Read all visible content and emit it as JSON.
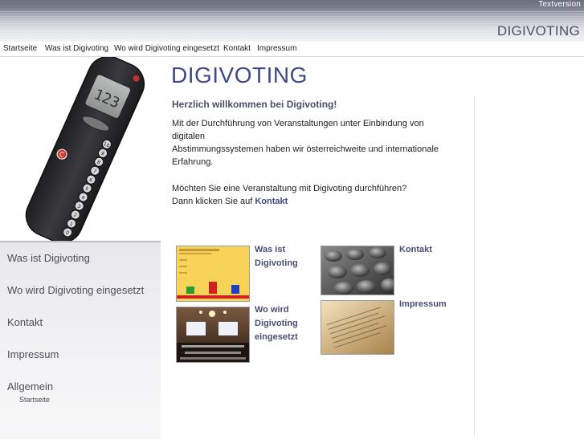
{
  "header": {
    "textversion_label": "Textversion",
    "brand": "DIGIVOTING"
  },
  "topnav": {
    "items": [
      "Startseite",
      "Was ist Digivoting",
      "Wo wird Digivoting eingesetzt",
      "Kontakt",
      "Impressum"
    ]
  },
  "device": {
    "display_value": "123",
    "keys": [
      "10",
      "9",
      "8",
      "7",
      "6",
      "5",
      "4",
      "3",
      "2",
      "1",
      "0"
    ],
    "clear_key": "C"
  },
  "sidebar": {
    "items": [
      "Was ist Digivoting",
      "Wo wird Digivoting eingesetzt",
      "Kontakt",
      "Impressum",
      "Allgemein"
    ],
    "sub_items": [
      "Startseite"
    ]
  },
  "main": {
    "title": "DIGIVOTING",
    "welcome": "Herzlich willkommen bei Digivoting!",
    "intro_lines": [
      "Mit der Durchführung von Veranstaltungen unter Einbindung von",
      "digitalen",
      "Abstimmungssystemen haben wir österreichweite und internationale",
      "Erfahrung."
    ],
    "question": "Möchten Sie eine Veranstaltung mit Digivoting durchführen?",
    "cta_prefix": "Dann klicken Sie auf",
    "cta_link": "Kontakt"
  },
  "tiles": [
    {
      "label_lines": [
        "Was ist",
        "Digivoting"
      ]
    },
    {
      "label_lines": [
        "Kontakt"
      ]
    },
    {
      "label_lines": [
        "Wo wird",
        "Digivoting",
        "eingesetzt"
      ]
    },
    {
      "label_lines": [
        "Impressum"
      ]
    }
  ],
  "colors": {
    "brand_blue": "#3f4a86",
    "chart_bg": "#f7d35a"
  }
}
